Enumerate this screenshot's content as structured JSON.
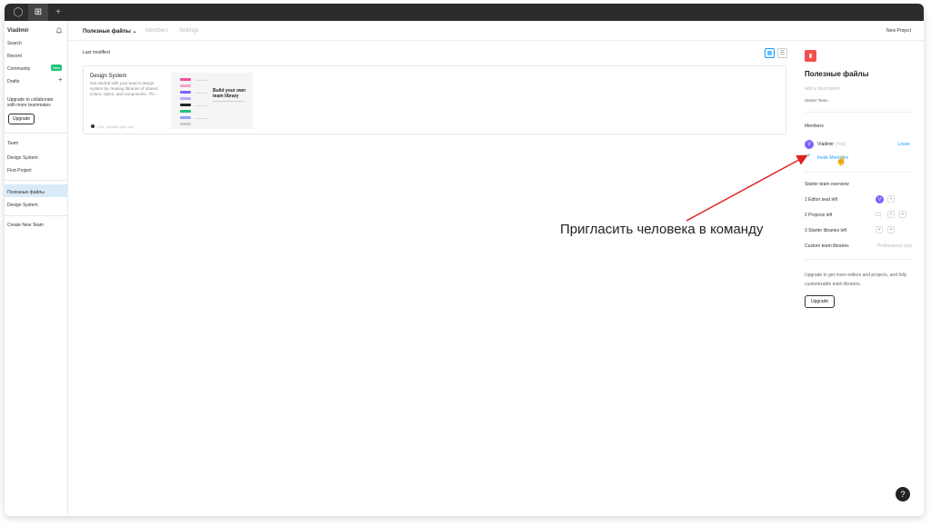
{
  "titlebar": {
    "home_icon": "circle-icon",
    "files_icon": "figma-icon",
    "add_tab": "+"
  },
  "sidebar": {
    "user": "Vladimir",
    "items": [
      "Search",
      "Recent",
      "Community",
      "Drafts"
    ],
    "community_badge": "New",
    "drafts_plus": "+",
    "upgrade_text": "Upgrade to collaborate with more teammates",
    "upgrade_button": "Upgrade",
    "team_header": "Team",
    "team_projects": [
      "Design System",
      "First Project"
    ],
    "selected_team": "Полезные файлы",
    "selected_team_projects": [
      "Design System"
    ],
    "create_team": "Create New Team"
  },
  "topnav": {
    "team_name": "Полезные файлы ⌄",
    "tabs": [
      "Members",
      "Settings"
    ],
    "new_project": "New Project"
  },
  "main": {
    "sort_label": "Last modified",
    "card": {
      "title": "Design System",
      "description": "Get started with your team's design system by creating libraries of shared colors, styles, and components. Thi…",
      "meta": "1 file, updated just now",
      "thumb_title": "Build your own team library"
    }
  },
  "rpanel": {
    "team_icon": "trash-icon",
    "team_name": "Полезные файлы",
    "add_description": "Add a description",
    "plan": "Starter Team",
    "members_header": "Members",
    "member_initial": "V",
    "member_name": "Vladimir",
    "member_you": "(You)",
    "leave": "Leave",
    "invite_plus": "+",
    "invite": "Invite Members",
    "overview_header": "Starter team overview",
    "rows": [
      "1 Editor seat left",
      "2 Projects left",
      "3 Starter libraries left",
      "Custom team libraries"
    ],
    "professional_only": "Professional only",
    "upgrade_text": "Upgrade to get more editors and projects, and fully customizable team libraries.",
    "upgrade_button": "Upgrade"
  },
  "annotation": {
    "text": "Пригласить человека в команду",
    "arrow_color": "#e02020"
  },
  "help": "?"
}
